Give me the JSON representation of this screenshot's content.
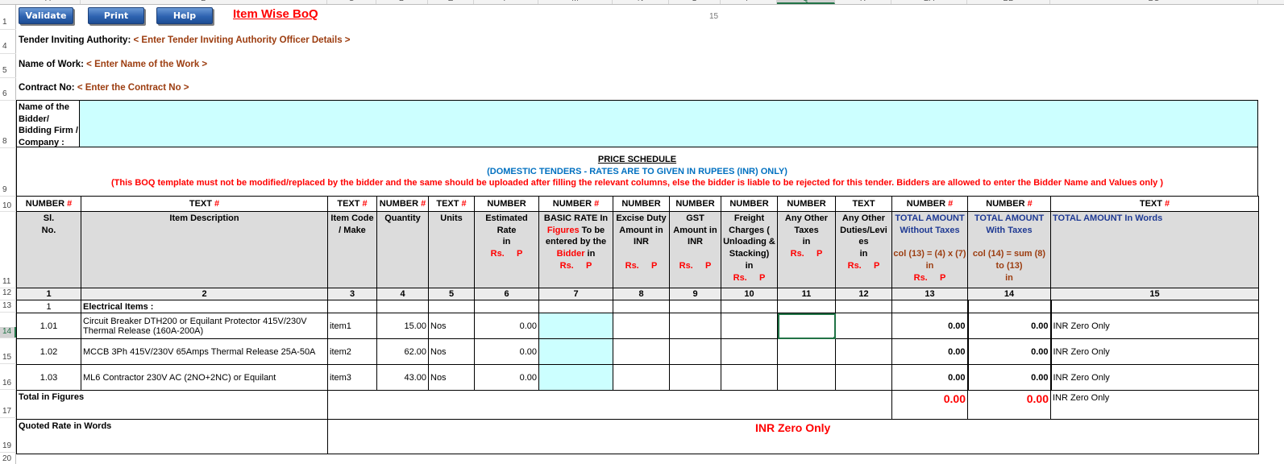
{
  "spreadsheet": {
    "columns": [
      "A",
      "B",
      "C",
      "D",
      "E",
      "F",
      "M",
      "N",
      "O",
      "P",
      "Q",
      "R",
      "BA",
      "BB",
      "BC"
    ],
    "selected_column": "Q",
    "rows": [
      "1",
      "4",
      "5",
      "6",
      "8",
      "9",
      "10",
      "11",
      "12",
      "13",
      "14",
      "15",
      "16",
      "17",
      "19",
      "20"
    ],
    "selected_row": "14",
    "page_number": "15"
  },
  "toolbar": {
    "validate_label": "Validate",
    "print_label": "Print",
    "help_label": "Help"
  },
  "header": {
    "title": "Item Wise BoQ",
    "tender_authority_label": "Tender Inviting Authority:",
    "tender_authority_value": "< Enter Tender Inviting Authority Officer Details >",
    "name_of_work_label": "Name of Work:",
    "name_of_work_value": "< Enter Name of the Work >",
    "contract_no_label": "Contract No:",
    "contract_no_value": "< Enter the Contract No >",
    "bidder_label_lines": [
      "Name of the",
      "Bidder/",
      "Bidding Firm /",
      "Company :"
    ],
    "bidder_value": ""
  },
  "price_schedule": {
    "title": "PRICE SCHEDULE",
    "subtitle": "(DOMESTIC TENDERS - RATES ARE TO GIVEN IN RUPEES (INR) ONLY)",
    "warning": "(This BOQ template must not be modified/replaced by the bidder and the same should be uploaded after filling the relevant columns, else the bidder is liable to be rejected for this tender. Bidders are allowed to enter the Bidder Name and Values only )"
  },
  "table": {
    "types": [
      {
        "t": "NUMBER",
        "hash": "#"
      },
      {
        "t": "TEXT",
        "hash": "#"
      },
      {
        "t": "TEXT",
        "hash": "#"
      },
      {
        "t": "NUMBER",
        "hash": "#"
      },
      {
        "t": "TEXT",
        "hash": "#"
      },
      {
        "t": "NUMBER",
        "hash": ""
      },
      {
        "t": "NUMBER",
        "hash": "#"
      },
      {
        "t": "NUMBER",
        "hash": ""
      },
      {
        "t": "NUMBER",
        "hash": ""
      },
      {
        "t": "NUMBER",
        "hash": ""
      },
      {
        "t": "NUMBER",
        "hash": ""
      },
      {
        "t": "TEXT",
        "hash": ""
      },
      {
        "t": "NUMBER",
        "hash": "#"
      },
      {
        "t": "NUMBER",
        "hash": "#"
      },
      {
        "t": "TEXT",
        "hash": "#"
      }
    ],
    "headers": {
      "sl_no": [
        "Sl.",
        "No."
      ],
      "item_description": "Item Description",
      "item_code": [
        "Item Code",
        "/ Make"
      ],
      "quantity": "Quantity",
      "units": "Units",
      "estimated_rate": [
        "Estimated",
        "Rate",
        "in"
      ],
      "basic_rate": {
        "p1": "BASIC RATE In",
        "p2_red": "Figures",
        "p2": " To be",
        "p3": "entered by the",
        "p4_red": "Bidder",
        "p4": "  in"
      },
      "excise_duty": [
        "Excise Duty",
        "Amount in",
        "INR"
      ],
      "gst": [
        "GST",
        "Amount in",
        "INR"
      ],
      "freight": [
        "Freight",
        "Charges (",
        "Unloading &",
        "Stacking)",
        "in"
      ],
      "other_taxes": [
        "Any Other",
        "Taxes",
        "in"
      ],
      "other_duties": [
        "Any Other",
        "Duties/Levi",
        "es",
        "in"
      ],
      "total_without": [
        "TOTAL AMOUNT",
        "Without Taxes"
      ],
      "total_without_formula": "col (13) = (4) x (7)",
      "total_with": [
        "TOTAL AMOUNT",
        "With Taxes"
      ],
      "total_with_formula": [
        "col (14) = sum (8)",
        "to (13)"
      ],
      "in": "in",
      "total_words": "TOTAL AMOUNT In Words",
      "rs": "Rs.",
      "p": "P"
    },
    "column_numbers": [
      "1",
      "2",
      "3",
      "4",
      "5",
      "6",
      "7",
      "8",
      "9",
      "10",
      "11",
      "12",
      "13",
      "14",
      "15"
    ],
    "category": {
      "sl_no": "1",
      "description": "Electrical Items :"
    },
    "items": [
      {
        "sl_no": "1.01",
        "description": "Circuit Breaker DTH200 or Equilant Protector 415V/230V Thermal Release (160A-200A)",
        "item_code": "item1",
        "quantity": "15.00",
        "units": "Nos",
        "estimated_rate": "0.00",
        "basic_rate": "",
        "excise_duty": "",
        "gst": "",
        "freight": "",
        "other_taxes": "",
        "other_duties": "",
        "total_without": "0.00",
        "total_with": "0.00",
        "total_words": "INR Zero Only"
      },
      {
        "sl_no": "1.02",
        "description": "MCCB 3Ph 415V/230V 65Amps Thermal Release 25A-50A",
        "item_code": "item2",
        "quantity": "62.00",
        "units": "Nos",
        "estimated_rate": "0.00",
        "basic_rate": "",
        "excise_duty": "",
        "gst": "",
        "freight": "",
        "other_taxes": "",
        "other_duties": "",
        "total_without": "0.00",
        "total_with": "0.00",
        "total_words": "INR Zero Only"
      },
      {
        "sl_no": "1.03",
        "description": "ML6 Contractor 230V AC (2NO+2NC) or Equilant",
        "item_code": "item3",
        "quantity": "43.00",
        "units": "Nos",
        "estimated_rate": "0.00",
        "basic_rate": "",
        "excise_duty": "",
        "gst": "",
        "freight": "",
        "other_taxes": "",
        "other_duties": "",
        "total_without": "0.00",
        "total_with": "0.00",
        "total_words": "INR Zero Only"
      }
    ],
    "total_in_figures_label": "Total in Figures",
    "total_without": "0.00",
    "total_with": "0.00",
    "total_words": "INR Zero Only",
    "quoted_rate_label": "Quoted Rate in Words",
    "quoted_rate_value": "INR Zero Only"
  },
  "colors": {
    "button": "#2e63b0",
    "title_red": "#ff0000",
    "placeholder_brown": "#9c3d10",
    "input_cyan": "#ccffff",
    "header_gray": "#dcdcdc",
    "subtitle_blue": "#0070c0",
    "selection_green": "#217346"
  }
}
